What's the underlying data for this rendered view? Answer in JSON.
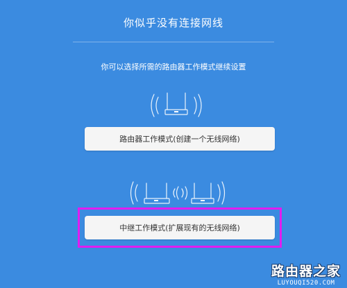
{
  "header": {
    "title": "你似乎没有连接网线",
    "subtitle": "你可以选择所需的路由器工作模式继续设置"
  },
  "modes": {
    "router_label": "路由器工作模式(创建一个无线网络)",
    "repeater_label": "中继工作模式(扩展现有的无线网络)"
  },
  "watermark": {
    "name": "路由器之家",
    "url": "LUYOUQI520.COM"
  },
  "colors": {
    "background": "#3b8be0",
    "highlight": "#e21cf0",
    "button": "#f5f5f5"
  },
  "icons": [
    "router-wifi-icon",
    "repeater-pair-icon"
  ]
}
